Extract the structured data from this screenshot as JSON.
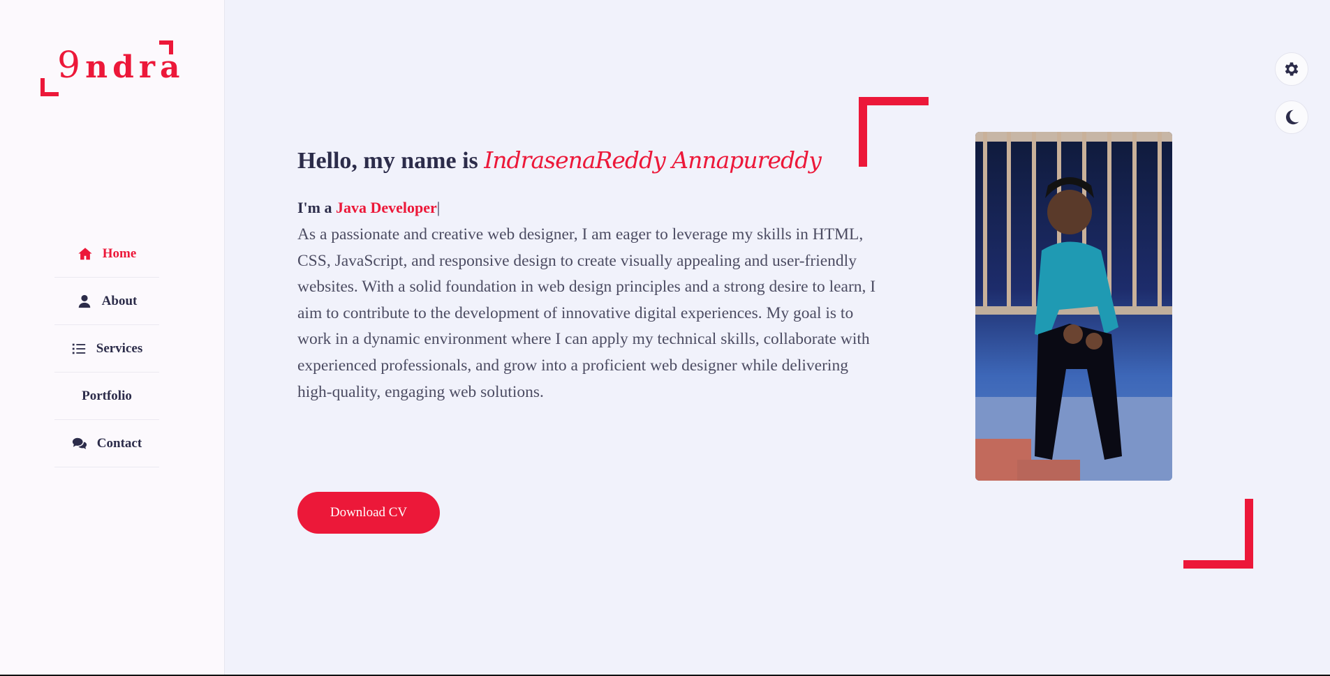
{
  "logo": {
    "first": "9",
    "rest": "ndra"
  },
  "nav": {
    "items": [
      {
        "label": "Home",
        "icon": "home-icon",
        "active": true
      },
      {
        "label": "About",
        "icon": "user-icon"
      },
      {
        "label": "Services",
        "icon": "list-icon"
      },
      {
        "label": "Portfolio",
        "icon": ""
      },
      {
        "label": "Contact",
        "icon": "comments-icon"
      }
    ]
  },
  "hero": {
    "greeting": "Hello, my name is ",
    "name": "IndrasenaReddy Annapureddy",
    "role_prefix": "I'm a ",
    "role": "Java Developer",
    "cursor": "|",
    "description": "As a passionate and creative web designer, I am eager to leverage my skills in HTML, CSS, JavaScript, and responsive design to create visually appealing and user-friendly websites. With a solid foundation in web design principles and a strong desire to learn, I aim to contribute to the development of innovative digital experiences. My goal is to work in a dynamic environment where I can apply my technical skills, collaborate with experienced professionals, and grow into a proficient web designer while delivering high-quality, engaging web solutions.",
    "button": "Download CV"
  },
  "colors": {
    "accent": "#ec1839",
    "text": "#2c2c4a",
    "background": "#f1f2fb"
  },
  "controls": {
    "settings_icon": "gear-icon",
    "theme_icon": "moon-icon"
  }
}
